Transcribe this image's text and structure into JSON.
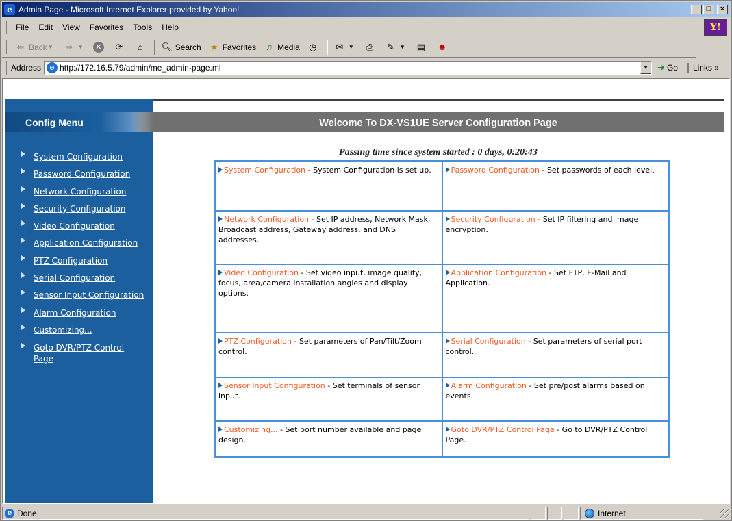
{
  "window": {
    "title": "Admin Page - Microsoft Internet Explorer provided by Yahoo!",
    "minimize_glyph": "_",
    "maximize_glyph": "□",
    "close_glyph": "×"
  },
  "menubar": {
    "items": [
      "File",
      "Edit",
      "View",
      "Favorites",
      "Tools",
      "Help"
    ],
    "yahoo_logo_text": "Y!"
  },
  "toolbar": {
    "back": "Back",
    "search": "Search",
    "favorites": "Favorites",
    "media": "Media"
  },
  "address": {
    "label": "Address",
    "url": "http://172.16.5.79/admin/me_admin-page.ml",
    "go": "Go",
    "links": "Links »"
  },
  "sidebar": {
    "title": "Config Menu",
    "items": [
      "System Configuration",
      "Password Configuration",
      "Network Configuration",
      "Security Configuration",
      "Video Configuration",
      "Application Configuration",
      "PTZ Configuration",
      "Serial Configuration",
      "Sensor Input Configuration",
      "Alarm Configuration",
      "Customizing...",
      "Goto DVR/PTZ Control Page"
    ]
  },
  "main": {
    "header": "Welcome To DX-VS1UE Server Configuration Page",
    "passing_time": "Passing time since system started : 0 days, 0:20:43",
    "cells": [
      {
        "link": "System Configuration",
        "desc": " - System Configuration is set up."
      },
      {
        "link": "Password Configuration",
        "desc": " - Set passwords of each level."
      },
      {
        "link": "Network Configuration",
        "desc": " - Set IP address, Network Mask, Broadcast address, Gateway address, and DNS addresses."
      },
      {
        "link": "Security Configuration",
        "desc": " - Set IP filtering and image encryption."
      },
      {
        "link": "Video Configuration",
        "desc": " - Set video input, image quality, focus, area,camera installation angles and display options."
      },
      {
        "link": "Application Configuration",
        "desc": " - Set FTP, E-Mail and Application."
      },
      {
        "link": "PTZ Configuration",
        "desc": " - Set parameters of Pan/Tilt/Zoom control."
      },
      {
        "link": "Serial Configuration",
        "desc": " - Set parameters of serial port control."
      },
      {
        "link": "Sensor Input Configuration",
        "desc": " - Set terminals of sensor input."
      },
      {
        "link": "Alarm Configuration",
        "desc": " - Set pre/post alarms based on events."
      },
      {
        "link": "Customizing...",
        "desc": " - Set port number available and page design."
      },
      {
        "link": "Goto DVR/PTZ Control Page",
        "desc": " - Go to DVR/PTZ Control Page."
      }
    ]
  },
  "status": {
    "text": "Done",
    "zone": "Internet"
  },
  "colors": {
    "sidebar_bg": "#1b5f9e",
    "header_bg": "#707070",
    "link_orange": "#f15a24",
    "grid_border": "#4a90d6"
  }
}
